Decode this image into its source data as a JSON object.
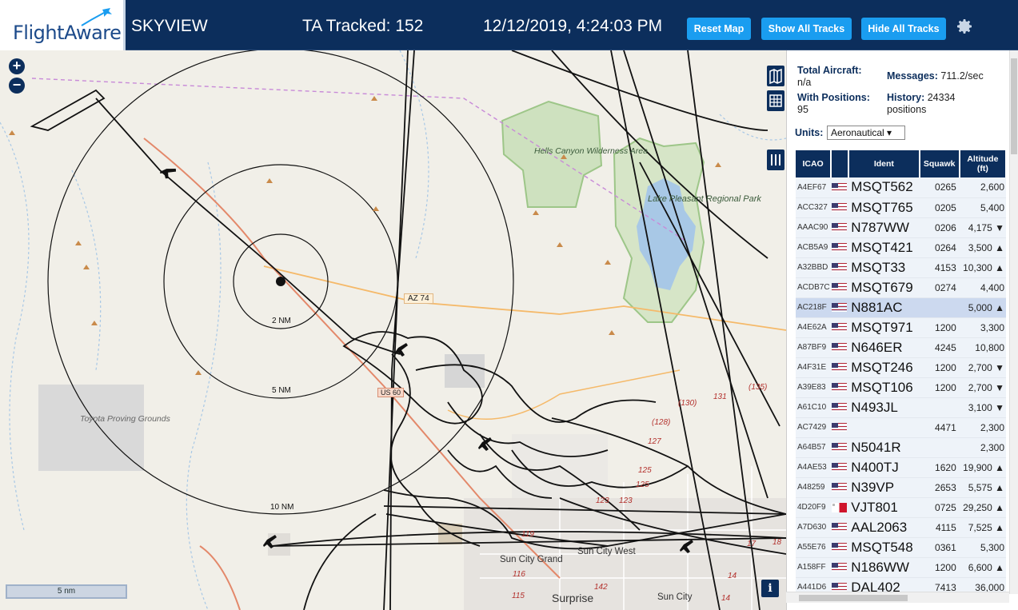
{
  "header": {
    "brand": "FlightAware",
    "title": "SKYVIEW",
    "ta_tracked": "TA Tracked: 152",
    "datetime": "12/12/2019, 4:24:03 PM",
    "buttons": {
      "reset_map": "Reset Map",
      "show_all": "Show All Tracks",
      "hide_all": "Hide All Tracks"
    },
    "icons": {
      "settings": "gear-icon"
    }
  },
  "map": {
    "zoom_in": "+",
    "zoom_out": "−",
    "scale": "5 nm",
    "info": "i",
    "rings": [
      "2 NM",
      "5 NM",
      "10 NM"
    ],
    "labels": {
      "hells_canyon": "Hells Canyon Wilderness Area",
      "lake_pleasant": "Lake Pleasant Regional Park",
      "toyota": "Toyota Proving Grounds",
      "az74": "AZ 74",
      "us60": "US 60",
      "sun_city_grand": "Sun City Grand",
      "sun_city_west": "Sun City West",
      "surprise": "Surprise",
      "sun_city": "Sun City"
    },
    "route_numbers": [
      "(130)",
      "131",
      "(135)",
      "(128)",
      "127",
      "125",
      "125",
      "123",
      "123",
      "119",
      "116",
      "115",
      "142",
      "14",
      "14",
      "18",
      "17"
    ],
    "colors": {
      "header": "#0c2e5c",
      "button": "#1a9df0",
      "track": "#111111",
      "water": "#a8c8e6",
      "park": "#8fbf78"
    }
  },
  "sidebar": {
    "total_aircraft_label": "Total Aircraft:",
    "total_aircraft_value": "n/a",
    "with_positions_label": "With Positions:",
    "with_positions_value": "95",
    "messages_label": "Messages:",
    "messages_value": "711.2/sec",
    "history_label": "History:",
    "history_value": "24334",
    "history_unit": "positions",
    "units_label": "Units:",
    "units_value": "Aeronautical ▾",
    "columns": [
      "ICAO",
      "",
      "Ident",
      "Squawk",
      "Altitude (ft)"
    ],
    "rows": [
      {
        "icao": "A4EF67",
        "flag": "us",
        "ident": "MSQT562",
        "squawk": "0265",
        "alt": "2,600"
      },
      {
        "icao": "ACC327",
        "flag": "us",
        "ident": "MSQT765",
        "squawk": "0205",
        "alt": "5,400"
      },
      {
        "icao": "AAAC90",
        "flag": "us",
        "ident": "N787WW",
        "squawk": "0206",
        "alt": "4,175 ▼"
      },
      {
        "icao": "ACB5A9",
        "flag": "us",
        "ident": "MSQT421",
        "squawk": "0264",
        "alt": "3,500 ▲"
      },
      {
        "icao": "A32BBD",
        "flag": "us",
        "ident": "MSQT33",
        "squawk": "4153",
        "alt": "10,300 ▲"
      },
      {
        "icao": "ACDB7C",
        "flag": "us",
        "ident": "MSQT679",
        "squawk": "0274",
        "alt": "4,400"
      },
      {
        "icao": "AC218F",
        "flag": "us",
        "ident": "N881AC",
        "squawk": "",
        "alt": "5,000 ▲"
      },
      {
        "icao": "A4E62A",
        "flag": "us",
        "ident": "MSQT971",
        "squawk": "1200",
        "alt": "3,300"
      },
      {
        "icao": "A87BF9",
        "flag": "us",
        "ident": "N646ER",
        "squawk": "4245",
        "alt": "10,800"
      },
      {
        "icao": "A4F31E",
        "flag": "us",
        "ident": "MSQT246",
        "squawk": "1200",
        "alt": "2,700 ▼"
      },
      {
        "icao": "A39E83",
        "flag": "us",
        "ident": "MSQT106",
        "squawk": "1200",
        "alt": "2,700 ▼"
      },
      {
        "icao": "A61C10",
        "flag": "us",
        "ident": "N493JL",
        "squawk": "",
        "alt": "3,100 ▼"
      },
      {
        "icao": "AC7429",
        "flag": "us",
        "ident": "",
        "squawk": "4471",
        "alt": "2,300"
      },
      {
        "icao": "A64B57",
        "flag": "us",
        "ident": "N5041R",
        "squawk": "",
        "alt": "2,300"
      },
      {
        "icao": "A4AE53",
        "flag": "us",
        "ident": "N400TJ",
        "squawk": "1620",
        "alt": "19,900 ▲"
      },
      {
        "icao": "A48259",
        "flag": "us",
        "ident": "N39VP",
        "squawk": "2653",
        "alt": "5,575 ▲"
      },
      {
        "icao": "4D20F9",
        "flag": "mt",
        "ident": "VJT801",
        "squawk": "0725",
        "alt": "29,250 ▲"
      },
      {
        "icao": "A7D630",
        "flag": "us",
        "ident": "AAL2063",
        "squawk": "4115",
        "alt": "7,525 ▲"
      },
      {
        "icao": "A55E76",
        "flag": "us",
        "ident": "MSQT548",
        "squawk": "0361",
        "alt": "5,300"
      },
      {
        "icao": "A158FF",
        "flag": "us",
        "ident": "N186WW",
        "squawk": "1200",
        "alt": "6,600 ▲"
      },
      {
        "icao": "A441D6",
        "flag": "us",
        "ident": "DAL402",
        "squawk": "7413",
        "alt": "36,000"
      }
    ],
    "selected_row": 6
  }
}
